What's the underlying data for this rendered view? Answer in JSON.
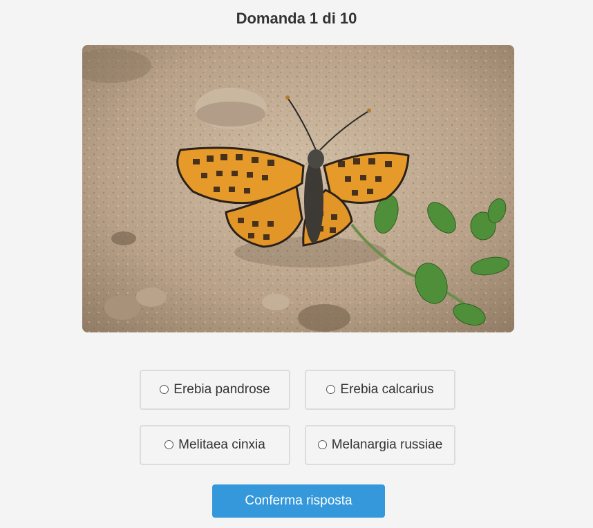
{
  "quiz": {
    "question_header": "Domanda 1 di 10",
    "image": {
      "subject_icon": "butterfly-photo"
    },
    "options": [
      {
        "label": "Erebia pandrose",
        "selected": false
      },
      {
        "label": "Erebia calcarius",
        "selected": false
      },
      {
        "label": "Melitaea cinxia",
        "selected": false
      },
      {
        "label": "Melanargia russiae",
        "selected": false
      }
    ],
    "confirm_label": "Conferma risposta"
  },
  "colors": {
    "background": "#f4f4f4",
    "accent": "#3498db",
    "option_border": "#dcdcdc",
    "text": "#333333"
  }
}
